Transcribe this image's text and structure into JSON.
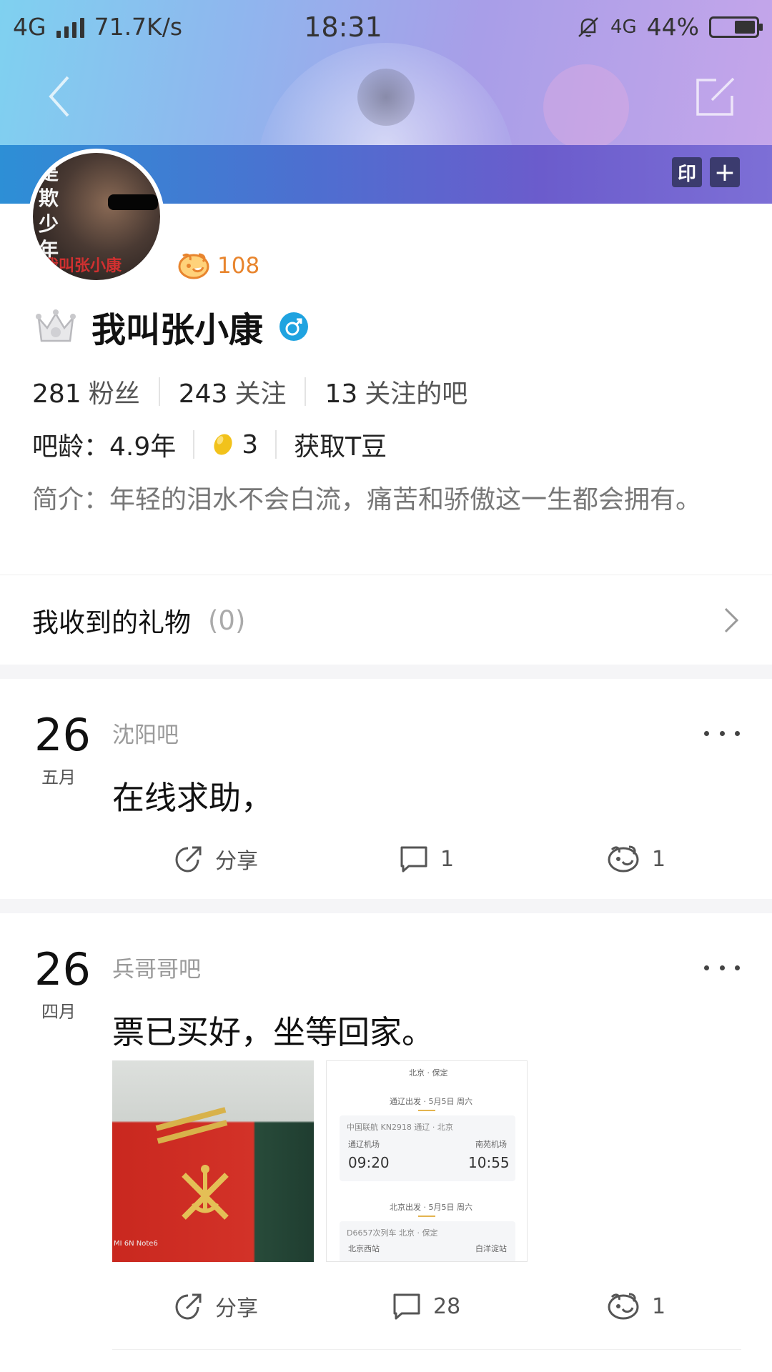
{
  "status_bar": {
    "network": "4G",
    "speed": "71.7K/s",
    "time": "18:31",
    "network_right": "4G",
    "battery": "44%"
  },
  "header": {
    "stamp_label": "印",
    "plus_label": "+"
  },
  "profile": {
    "avatar_text_vertical": "是欺少年",
    "avatar_text_bottom": "我叫张小康",
    "like_count": "108",
    "name": "我叫张小康",
    "stats": [
      {
        "num": "281",
        "label": "粉丝"
      },
      {
        "num": "243",
        "label": "关注"
      },
      {
        "num": "13",
        "label": "关注的吧"
      }
    ],
    "age_label": "吧龄：4.9年",
    "tbean_count": "3",
    "get_tbean_label": "获取T豆",
    "bio": "简介：年轻的泪水不会白流，痛苦和骄傲这一生都会拥有。"
  },
  "gifts": {
    "title": "我收到的礼物",
    "count": "(0)"
  },
  "posts": [
    {
      "day": "26",
      "month": "五月",
      "forum": "沈阳吧",
      "text": "在线求助，",
      "share_label": "分享",
      "comment_count": "1",
      "like_count": "1"
    },
    {
      "day": "26",
      "month": "四月",
      "forum": "兵哥哥吧",
      "text": "票已买好，坐等回家。",
      "share_label": "分享",
      "comment_count": "28",
      "like_count": "1",
      "thumb1_watermark": "MI 6N Note6",
      "ticket": {
        "route": "北京 · 保定",
        "leg1_header": "通辽出发 · 5月5日 周六",
        "leg1_flight": "中国联航 KN2918 通辽 · 北京",
        "leg1_from": "通辽机场",
        "leg1_to": "南苑机场",
        "leg1_dep": "09:20",
        "leg1_arr": "10:55",
        "leg2_header": "北京出发 · 5月5日 周六",
        "leg2_train": "D6657次列车 北京 · 保定",
        "leg2_from": "北京西站",
        "leg2_to": "白洋淀站"
      }
    }
  ],
  "colors": {
    "like_orange": "#e8852e",
    "gender_blue": "#1fa3e0",
    "text_dark": "#111111",
    "text_gray": "#9a9a9a"
  },
  "icons": {
    "back": "chevron-left-icon",
    "edit": "edit-icon",
    "crown": "crown-icon",
    "gender": "male-icon",
    "like": "like-face-icon",
    "tbean": "bean-icon",
    "chevron": "chevron-right-icon",
    "share": "share-icon",
    "comment": "comment-icon",
    "more": "more-icon"
  }
}
